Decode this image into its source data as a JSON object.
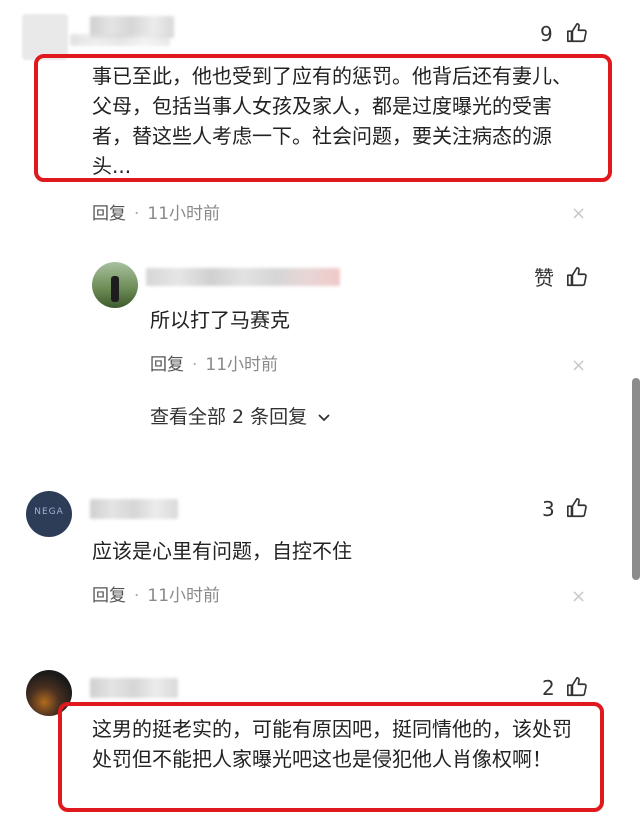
{
  "comments": [
    {
      "like_count": "9",
      "text": "事已至此，他也受到了应有的惩罚。他背后还有妻儿、父母，包括当事人女孩及家人，都是过度曝光的受害者，替这些人考虑一下。社会问题，要关注病态的源头...",
      "reply_label": "回复",
      "time": "11小时前"
    },
    {
      "like_count": "赞",
      "text": "所以打了马赛克",
      "reply_label": "回复",
      "time": "11小时前",
      "view_all": "查看全部 2 条回复"
    },
    {
      "like_count": "3",
      "text": "应该是心里有问题，自控不住",
      "reply_label": "回复",
      "time": "11小时前"
    },
    {
      "like_count": "2",
      "text": "这男的挺老实的，可能有原因吧，挺同情他的，该处罚处罚但不能把人家曝光吧这也是侵犯他人肖像权啊！"
    }
  ],
  "close_symbol": "×",
  "dot_symbol": "·",
  "avatar_text": "NEGA",
  "colors": {
    "highlight": "#e0191f",
    "meta": "#8a8a8a"
  }
}
